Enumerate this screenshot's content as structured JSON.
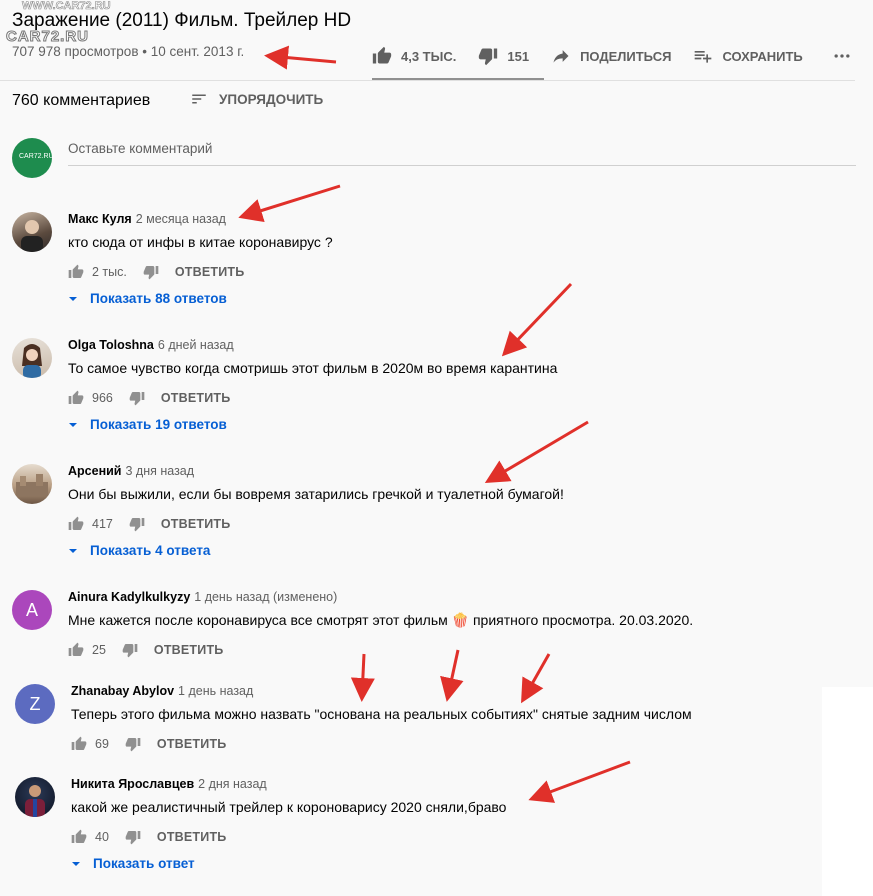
{
  "watermark": {
    "top": "WWW.CAR72.RU",
    "bottom": "CAR72.RU"
  },
  "video": {
    "title": "Заражение (2011) Фильм. Трейлер HD",
    "views": "707 978 просмотров",
    "date": "10 сент. 2013 г."
  },
  "actions": {
    "likes": "4,3 ТЫС.",
    "dislikes": "151",
    "share": "ПОДЕЛИТЬСЯ",
    "save": "СОХРАНИТЬ"
  },
  "comments_header": {
    "count": "760 комментариев",
    "sort": "УПОРЯДОЧИТЬ",
    "placeholder": "Оставьте комментарий",
    "my_avatar_text": "CAR72.RU"
  },
  "colors": {
    "accent_blue": "#065fd4",
    "arrow_red": "#e0302a",
    "avatar_purple": "#ab47bc",
    "avatar_indigo": "#5c6bc0"
  },
  "comments": [
    {
      "author": "Макс Куля",
      "time": "2 месяца назад",
      "text": "кто сюда от инфы в китае коронавирус ?",
      "likes": "2 тыс.",
      "reply": "ОТВЕТИТЬ",
      "replies": "Показать 88 ответов",
      "avatar": "photo"
    },
    {
      "author": "Olga Toloshna",
      "time": "6 дней назад",
      "text": "То самое чувство когда смотришь этот фильм в 2020м во время карантина",
      "likes": "966",
      "reply": "ОТВЕТИТЬ",
      "replies": "Показать 19 ответов",
      "avatar": "photo"
    },
    {
      "author": "Арсений",
      "time": "3 дня назад",
      "text": "Они бы выжили, если бы вовремя затарились гречкой и туалетной бумагой!",
      "likes": "417",
      "reply": "ОТВЕТИТЬ",
      "replies": "Показать 4 ответа",
      "avatar": "photo"
    },
    {
      "author": "Ainura Kadylkulkyzy",
      "time": "1 день назад (изменено)",
      "text": "Мне кажется после коронавируса все смотрят этот фильм 🍿 приятного просмотра. 20.03.2020.",
      "likes": "25",
      "reply": "ОТВЕТИТЬ",
      "avatar_letter": "A"
    },
    {
      "author": "Zhanabay Abylov",
      "time": "1 день назад",
      "text": "Теперь этого фильма можно назвать \"основана на реальных событиях\" снятые задним числом",
      "likes": "69",
      "reply": "ОТВЕТИТЬ",
      "avatar_letter": "Z"
    },
    {
      "author": "Никита Ярославцев",
      "time": "2 дня назад",
      "text": "какой же реалистичный трейлер к короновариcу 2020 сняли,браво",
      "likes": "40",
      "reply": "ОТВЕТИТЬ",
      "replies": "Показать ответ",
      "avatar": "photo"
    }
  ]
}
